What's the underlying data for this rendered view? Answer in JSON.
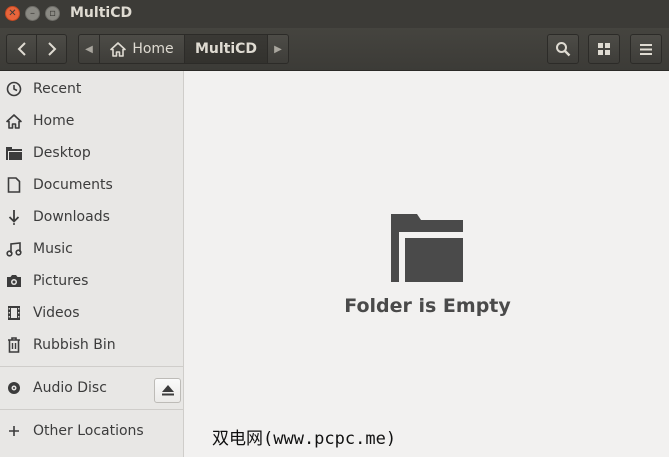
{
  "window": {
    "title": "MultiCD"
  },
  "toolbar": {
    "path": [
      {
        "label": "Home",
        "icon": "home-icon"
      },
      {
        "label": "MultiCD"
      }
    ]
  },
  "sidebar": {
    "places": [
      {
        "label": "Recent",
        "icon": "clock-icon"
      },
      {
        "label": "Home",
        "icon": "home-icon"
      },
      {
        "label": "Desktop",
        "icon": "folder-icon"
      },
      {
        "label": "Documents",
        "icon": "document-icon"
      },
      {
        "label": "Downloads",
        "icon": "download-icon"
      },
      {
        "label": "Music",
        "icon": "music-icon"
      },
      {
        "label": "Pictures",
        "icon": "camera-icon"
      },
      {
        "label": "Videos",
        "icon": "video-icon"
      },
      {
        "label": "Rubbish Bin",
        "icon": "trash-icon"
      }
    ],
    "devices": [
      {
        "label": "Audio Disc",
        "icon": "disc-icon"
      }
    ],
    "other": {
      "label": "Other Locations",
      "icon": "plus-icon"
    }
  },
  "main": {
    "empty_label": "Folder is Empty"
  },
  "watermark": "双电网(www.pcpc.me)"
}
